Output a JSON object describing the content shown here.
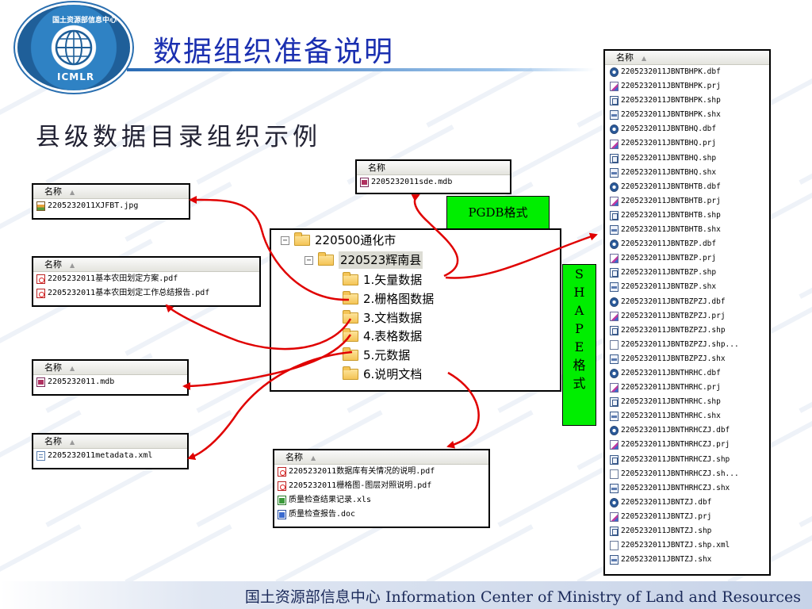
{
  "header": {
    "title": "数据组织准备说明",
    "logo_top_text": "国土资源部信息中心",
    "logo_bottom_text": "ICMLR"
  },
  "subtitle": "县级数据目录组织示例",
  "panel_header": "名称",
  "panels": {
    "jpg": {
      "files": [
        {
          "icon": "jpg",
          "name": "2205232011XJFBT.jpg"
        }
      ]
    },
    "pdf": {
      "files": [
        {
          "icon": "pdf",
          "name": "2205232011基本农田划定方案.pdf"
        },
        {
          "icon": "pdf",
          "name": "2205232011基本农田划定工作总结报告.pdf"
        }
      ]
    },
    "mdb": {
      "files": [
        {
          "icon": "mdb",
          "name": "2205232011.mdb"
        }
      ]
    },
    "xml": {
      "files": [
        {
          "icon": "xml",
          "name": "2205232011metadata.xml"
        }
      ]
    },
    "sde": {
      "files": [
        {
          "icon": "mdb",
          "name": "2205232011sde.mdb"
        }
      ]
    },
    "docs": {
      "files": [
        {
          "icon": "pdf",
          "name": "2205232011数据库有关情况的说明.pdf"
        },
        {
          "icon": "pdf",
          "name": "2205232011栅格图-图层对照说明.pdf"
        },
        {
          "icon": "xls",
          "name": "质量检查结果记录.xls"
        },
        {
          "icon": "doc",
          "name": "质量检查报告.doc"
        }
      ]
    }
  },
  "tree": {
    "root": "220500通化市",
    "county": "220523辉南县",
    "folders": [
      "1.矢量数据",
      "2.栅格图数据",
      "3.文档数据",
      "4.表格数据",
      "5.元数据",
      "6.说明文档"
    ]
  },
  "labels": {
    "pgdb": "PGDB格式",
    "shape": [
      "S",
      "H",
      "A",
      "P",
      "E",
      "格",
      "式"
    ]
  },
  "shape_files": [
    {
      "icon": "dbf",
      "name": "2205232011JBNTBHPK.dbf"
    },
    {
      "icon": "prj",
      "name": "2205232011JBNTBHPK.prj"
    },
    {
      "icon": "shp",
      "name": "2205232011JBNTBHPK.shp"
    },
    {
      "icon": "shx",
      "name": "2205232011JBNTBHPK.shx"
    },
    {
      "icon": "dbf",
      "name": "2205232011JBNTBHQ.dbf"
    },
    {
      "icon": "prj",
      "name": "2205232011JBNTBHQ.prj"
    },
    {
      "icon": "shp",
      "name": "2205232011JBNTBHQ.shp"
    },
    {
      "icon": "shx",
      "name": "2205232011JBNTBHQ.shx"
    },
    {
      "icon": "dbf",
      "name": "2205232011JBNTBHTB.dbf"
    },
    {
      "icon": "prj",
      "name": "2205232011JBNTBHTB.prj"
    },
    {
      "icon": "shp",
      "name": "2205232011JBNTBHTB.shp"
    },
    {
      "icon": "shx",
      "name": "2205232011JBNTBHTB.shx"
    },
    {
      "icon": "dbf",
      "name": "2205232011JBNTBZP.dbf"
    },
    {
      "icon": "prj",
      "name": "2205232011JBNTBZP.prj"
    },
    {
      "icon": "shp",
      "name": "2205232011JBNTBZP.shp"
    },
    {
      "icon": "shx",
      "name": "2205232011JBNTBZP.shx"
    },
    {
      "icon": "dbf",
      "name": "2205232011JBNTBZPZJ.dbf"
    },
    {
      "icon": "prj",
      "name": "2205232011JBNTBZPZJ.prj"
    },
    {
      "icon": "shp",
      "name": "2205232011JBNTBZPZJ.shp"
    },
    {
      "icon": "gen",
      "name": "2205232011JBNTBZPZJ.shp..."
    },
    {
      "icon": "shx",
      "name": "2205232011JBNTBZPZJ.shx"
    },
    {
      "icon": "dbf",
      "name": "2205232011JBNTHRHC.dbf"
    },
    {
      "icon": "prj",
      "name": "2205232011JBNTHRHC.prj"
    },
    {
      "icon": "shp",
      "name": "2205232011JBNTHRHC.shp"
    },
    {
      "icon": "shx",
      "name": "2205232011JBNTHRHC.shx"
    },
    {
      "icon": "dbf",
      "name": "2205232011JBNTHRHCZJ.dbf"
    },
    {
      "icon": "prj",
      "name": "2205232011JBNTHRHCZJ.prj"
    },
    {
      "icon": "shp",
      "name": "2205232011JBNTHRHCZJ.shp"
    },
    {
      "icon": "gen",
      "name": "2205232011JBNTHRHCZJ.sh..."
    },
    {
      "icon": "shx",
      "name": "2205232011JBNTHRHCZJ.shx"
    },
    {
      "icon": "dbf",
      "name": "2205232011JBNTZJ.dbf"
    },
    {
      "icon": "prj",
      "name": "2205232011JBNTZJ.prj"
    },
    {
      "icon": "shp",
      "name": "2205232011JBNTZJ.shp"
    },
    {
      "icon": "gen",
      "name": "2205232011JBNTZJ.shp.xml"
    },
    {
      "icon": "shx",
      "name": "2205232011JBNTZJ.shx"
    }
  ],
  "footer": "国土资源部信息中心  Information Center of Ministry of Land and Resources",
  "colors": {
    "title": "#1a2fb0",
    "arrow": "#e00000",
    "green_label": "#00ee00"
  }
}
